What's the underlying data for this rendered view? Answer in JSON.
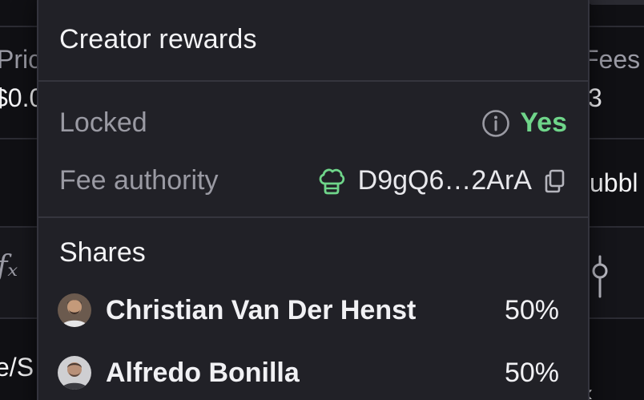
{
  "popover": {
    "title": "Creator rewards",
    "locked": {
      "label": "Locked",
      "value": "Yes",
      "info_icon": "info-icon",
      "value_color": "#6fd58a"
    },
    "fee_authority": {
      "label": "Fee authority",
      "address": "D9gQ6…2ArA",
      "chef_icon": "chef-hat-icon",
      "copy_icon": "copy-icon",
      "icon_color": "#6fd58a"
    },
    "shares": {
      "title": "Shares",
      "items": [
        {
          "name": "Christian Van Der Henst",
          "percent": "50%"
        },
        {
          "name": "Alfredo Bonilla",
          "percent": "50%"
        }
      ]
    }
  },
  "background": {
    "left_col_header": "Pric",
    "left_col_value": "$0.0",
    "right_col_header": "Fees",
    "right_col_value": "3",
    "right_row_text": "ubbl",
    "left_row_symbol": "fₓ",
    "left_bottom_text": "e/S"
  }
}
